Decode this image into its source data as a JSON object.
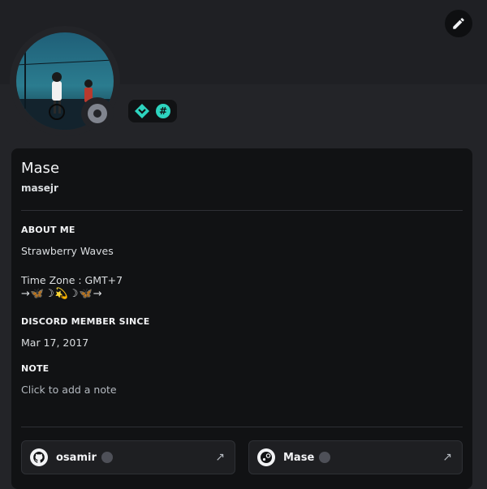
{
  "profile": {
    "display_name": "Mase",
    "username": "masejr"
  },
  "sections": {
    "about_title": "ABOUT ME",
    "about_line1": "Strawberry Waves",
    "about_line2": "Time Zone : GMT+7",
    "about_line3": "→🦋☽💫☽🦋→",
    "member_title": "DISCORD MEMBER SINCE",
    "member_since": "Mar 17, 2017",
    "note_title": "NOTE",
    "note_placeholder": "Click to add a note"
  },
  "connections": [
    {
      "name": "osamir",
      "service": "github"
    },
    {
      "name": "Mase",
      "service": "steam"
    }
  ],
  "icons": {
    "edit": "pencil-icon",
    "badge1": "hypesquad-balance-icon",
    "badge2": "hashtag-badge-icon",
    "status": "offline-status-icon"
  },
  "colors": {
    "accent_teal": "#2dd4bf",
    "status_offline": "#80848e"
  }
}
